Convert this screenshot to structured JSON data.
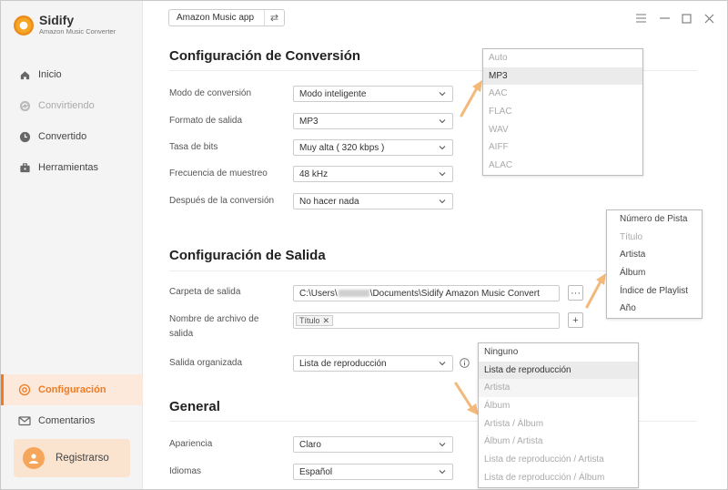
{
  "app": {
    "name": "Sidify",
    "subtitle": "Amazon Music Converter",
    "source_button": "Amazon Music app"
  },
  "sidebar": {
    "items": [
      {
        "label": "Inicio",
        "icon": "home-icon",
        "enabled": true
      },
      {
        "label": "Convirtiendo",
        "icon": "sync-icon",
        "enabled": false
      },
      {
        "label": "Convertido",
        "icon": "clock-icon",
        "enabled": true
      },
      {
        "label": "Herramientas",
        "icon": "toolbox-icon",
        "enabled": true
      }
    ],
    "bottom": [
      {
        "label": "Configuración",
        "icon": "settings-icon",
        "active": true
      },
      {
        "label": "Comentarios",
        "icon": "mail-icon",
        "active": false
      }
    ],
    "register_label": "Registrarso"
  },
  "sections": {
    "conversion": {
      "title": "Configuración de Conversión",
      "fields": [
        {
          "label": "Modo de conversión",
          "value": "Modo inteligente"
        },
        {
          "label": "Formato de salida",
          "value": "MP3"
        },
        {
          "label": "Tasa de bits",
          "value": "Muy alta ( 320 kbps )"
        },
        {
          "label": "Frecuencia de muestreo",
          "value": "48 kHz"
        },
        {
          "label": "Después de la conversión",
          "value": "No hacer nada"
        }
      ]
    },
    "output": {
      "title": "Configuración de Salida",
      "folder_label": "Carpeta de salida",
      "folder_prefix": "C:\\Users\\",
      "folder_suffix": "\\Documents\\Sidify Amazon Music Convert",
      "folder_button": "···",
      "filename_label_1": "Nombre de archivo de",
      "filename_label_2": "salida",
      "filename_tag": "Título",
      "filename_add": "+",
      "organized_label": "Salida organizada",
      "organized_value": "Lista de reproducción"
    },
    "general": {
      "title": "General",
      "fields": [
        {
          "label": "Apariencia",
          "value": "Claro"
        },
        {
          "label": "Idiomas",
          "value": "Español"
        }
      ]
    }
  },
  "format_dropdown": {
    "options": [
      {
        "label": "Auto",
        "state": "disabled"
      },
      {
        "label": "MP3",
        "state": "selected"
      },
      {
        "label": "AAC",
        "state": "disabled"
      },
      {
        "label": "FLAC",
        "state": "disabled"
      },
      {
        "label": "WAV",
        "state": "disabled"
      },
      {
        "label": "AIFF",
        "state": "disabled"
      },
      {
        "label": "ALAC",
        "state": "disabled"
      }
    ]
  },
  "filename_dropdown": {
    "options": [
      {
        "label": "Número de Pista",
        "state": "normal"
      },
      {
        "label": "Título",
        "state": "disabled"
      },
      {
        "label": "Artista",
        "state": "normal"
      },
      {
        "label": "Álbum",
        "state": "normal"
      },
      {
        "label": "Índice de Playlist",
        "state": "normal"
      },
      {
        "label": "Año",
        "state": "normal"
      }
    ]
  },
  "organized_dropdown": {
    "options": [
      {
        "label": "Ninguno",
        "state": "normal"
      },
      {
        "label": "Lista de reproducción",
        "state": "selected"
      },
      {
        "label": "Artista",
        "state": "hover"
      },
      {
        "label": "Álbum",
        "state": "disabled"
      },
      {
        "label": "Artista / Álbum",
        "state": "disabled"
      },
      {
        "label": "Álbum / Artista",
        "state": "disabled"
      },
      {
        "label": "Lista de reproducción / Artista",
        "state": "disabled"
      },
      {
        "label": "Lista de reproducción / Álbum",
        "state": "disabled"
      }
    ]
  },
  "colors": {
    "accent": "#f07b21",
    "annotation_arrow": "#f3b97a"
  }
}
